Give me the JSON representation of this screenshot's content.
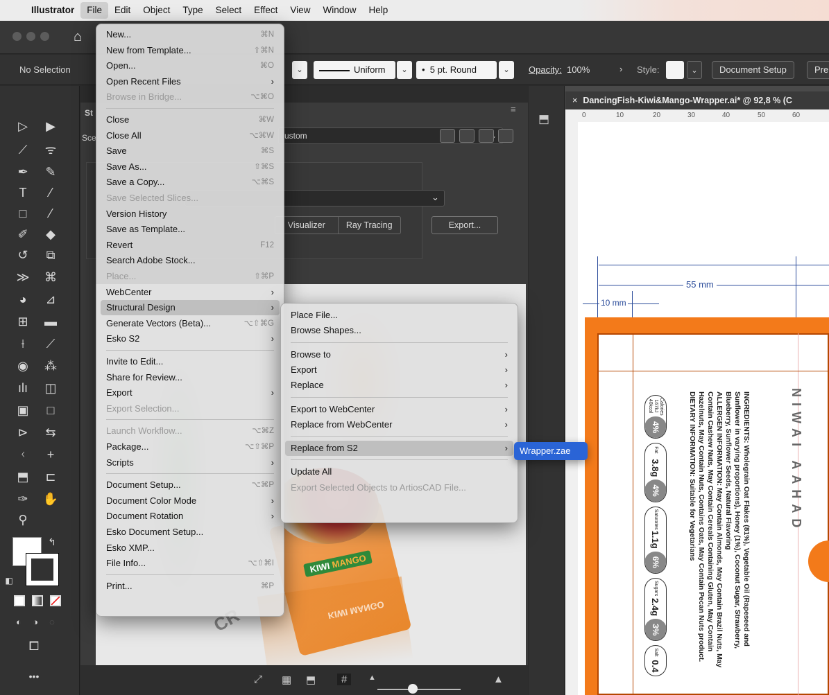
{
  "menubar": {
    "app": "Illustrator",
    "items": [
      "File",
      "Edit",
      "Object",
      "Type",
      "Select",
      "Effect",
      "View",
      "Window",
      "Help"
    ]
  },
  "controlbar": {
    "selection": "No Selection",
    "stroke_profile": "Uniform",
    "brush": "5 pt. Round",
    "opacity_label": "Opacity:",
    "opacity_value": "100%",
    "style_label": "Style:",
    "document_setup": "Document Setup",
    "preferences_partial": "Pre"
  },
  "panel": {
    "title_partial": "St",
    "scene_label_partial": "Sce",
    "scene_value_partial": "ustom",
    "tabs": [
      "Visualizer",
      "Ray Tracing"
    ],
    "export_button": "Export...",
    "pack_label_1": "KIWI",
    "pack_label_2": "MANGO",
    "reflection_label": "KIWI MANGO",
    "badge_partial": "CR"
  },
  "document": {
    "tab_title": "DancingFish-Kiwi&Mango-Wrapper.ai* @ 92,8 % (C",
    "ruler_ticks": [
      "0",
      "10",
      "20",
      "30",
      "40",
      "50",
      "60"
    ],
    "dim_55": "55 mm",
    "dim_10": "10 mm",
    "ingredients": [
      "INGREDIENTS: Wholegrain Oat Flakes (81%), Vegetable Oil (Rapeseed and",
      "Sunflower in varying proportions), Honey (1%), Coconut Sugar, Strawberry,",
      "Blueberry, Sunflower Seeds, Natural Flavoring",
      "ALLERGEN INFORMATION: May Contain Almonds, May Contain Brazil Nuts, May",
      "Contain Cashew Nuts, May Contain Cereals Containing Gluten, May Contain",
      "Hazelnuts, May Contain Nuts, Contains Oats, May Contain Pecan Nuts product.",
      "DIETARY INFORMATION: Suitable for Vegetarians"
    ],
    "nutrition": [
      {
        "label": "Calories 167kJ 40kcal",
        "value": "",
        "pct": "4%"
      },
      {
        "label": "Fat",
        "value": "3.8g",
        "pct": "4%"
      },
      {
        "label": "Saturates",
        "value": "1.1g",
        "pct": "6%"
      },
      {
        "label": "Sugars",
        "value": "2.4g",
        "pct": "3%"
      },
      {
        "label": "Salt",
        "value": "0.4",
        "pct": ""
      }
    ],
    "brand_partial": "NIWAI AAHAD"
  },
  "file_menu": [
    {
      "label": "New...",
      "shortcut": "⌘N"
    },
    {
      "label": "New from Template...",
      "shortcut": "⇧⌘N"
    },
    {
      "label": "Open...",
      "shortcut": "⌘O"
    },
    {
      "label": "Open Recent Files",
      "submenu": true
    },
    {
      "label": "Browse in Bridge...",
      "shortcut": "⌥⌘O",
      "disabled": true
    },
    {
      "sep": true
    },
    {
      "label": "Close",
      "shortcut": "⌘W"
    },
    {
      "label": "Close All",
      "shortcut": "⌥⌘W"
    },
    {
      "label": "Save",
      "shortcut": "⌘S"
    },
    {
      "label": "Save As...",
      "shortcut": "⇧⌘S"
    },
    {
      "label": "Save a Copy...",
      "shortcut": "⌥⌘S"
    },
    {
      "label": "Save Selected Slices...",
      "disabled": true
    },
    {
      "label": "Version History"
    },
    {
      "label": "Save as Template..."
    },
    {
      "label": "Revert",
      "shortcut": "F12"
    },
    {
      "label": "Search Adobe Stock..."
    },
    {
      "label": "Place...",
      "shortcut": "⇧⌘P",
      "disabled": true
    },
    {
      "label": "WebCenter",
      "submenu": true
    },
    {
      "label": "Structural Design",
      "submenu": true,
      "highlight": true
    },
    {
      "label": "Generate Vectors (Beta)...",
      "shortcut": "⌥⇧⌘G"
    },
    {
      "label": "Esko S2",
      "submenu": true
    },
    {
      "sep": true
    },
    {
      "label": "Invite to Edit..."
    },
    {
      "label": "Share for Review..."
    },
    {
      "label": "Export",
      "submenu": true
    },
    {
      "label": "Export Selection...",
      "disabled": true
    },
    {
      "sep": true
    },
    {
      "label": "Launch Workflow...",
      "shortcut": "⌥⌘Z",
      "disabled": true
    },
    {
      "label": "Package...",
      "shortcut": "⌥⇧⌘P"
    },
    {
      "label": "Scripts",
      "submenu": true
    },
    {
      "sep": true
    },
    {
      "label": "Document Setup...",
      "shortcut": "⌥⌘P"
    },
    {
      "label": "Document Color Mode",
      "submenu": true
    },
    {
      "label": "Document Rotation",
      "submenu": true
    },
    {
      "label": "Esko Document Setup..."
    },
    {
      "label": "Esko XMP..."
    },
    {
      "label": "File Info...",
      "shortcut": "⌥⇧⌘I"
    },
    {
      "sep": true
    },
    {
      "label": "Print...",
      "shortcut": "⌘P"
    }
  ],
  "structural_menu": [
    {
      "label": "Place File..."
    },
    {
      "label": "Browse Shapes..."
    },
    {
      "sep": true
    },
    {
      "label": "Browse to",
      "submenu": true
    },
    {
      "label": "Export",
      "submenu": true
    },
    {
      "label": "Replace",
      "submenu": true
    },
    {
      "sep": true
    },
    {
      "label": "Export to WebCenter",
      "submenu": true
    },
    {
      "label": "Replace from WebCenter",
      "submenu": true
    },
    {
      "sep": true
    },
    {
      "label": "Replace from S2",
      "submenu": true,
      "highlight": true
    },
    {
      "sep": true
    },
    {
      "label": "Update All"
    },
    {
      "label": "Export Selected Objects to ArtiosCAD File...",
      "disabled": true
    }
  ],
  "s2_submenu": {
    "label": "Wrapper.zae"
  },
  "colors": {
    "accent": "#2a64d6",
    "orange": "#f37a1a",
    "dim_blue": "#2a4b9a"
  }
}
